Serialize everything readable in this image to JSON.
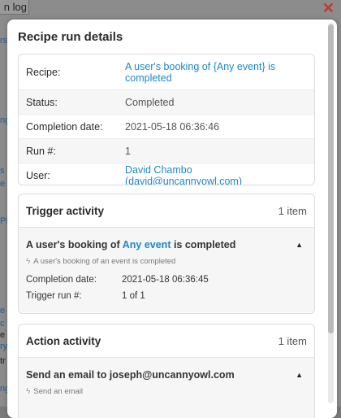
{
  "background": {
    "tab_label": "n log",
    "close_glyph": "✕",
    "fragments": [
      "rs",
      "ng",
      "s",
      "e",
      "PI",
      "e",
      "c",
      "e",
      "ry",
      "tr",
      "ng"
    ]
  },
  "modal": {
    "title": "Recipe run details",
    "details": [
      {
        "label": "Recipe:",
        "value": "A user's booking of {Any event} is completed",
        "link": true
      },
      {
        "label": "Status:",
        "value": "Completed",
        "link": false
      },
      {
        "label": "Completion date:",
        "value": "2021-05-18 06:36:46",
        "link": false
      },
      {
        "label": "Run #:",
        "value": "1",
        "link": false
      },
      {
        "label": "User:",
        "value": "David Chambo (david@uncannyowl.com)",
        "link": true
      }
    ],
    "trigger": {
      "title": "Trigger activity",
      "count": "1 item",
      "item": {
        "title_pre": "A user's booking of ",
        "title_hl": "Any event",
        "title_post": " is completed",
        "subtitle": "A user's booking of an event is completed",
        "completion_label": "Completion date:",
        "completion_value": "2021-05-18 06:36:45",
        "run_label": "Trigger run #:",
        "run_value": "1 of 1"
      }
    },
    "action": {
      "title": "Action activity",
      "count": "1 item",
      "item": {
        "title": "Send an email to joseph@uncannyowl.com",
        "subtitle": "Send an email"
      }
    }
  },
  "icons": {
    "caret": "caret-up-icon",
    "bolt": "bolt-icon"
  },
  "colors": {
    "accent": "#1e88c8",
    "close": "#c0392b"
  }
}
